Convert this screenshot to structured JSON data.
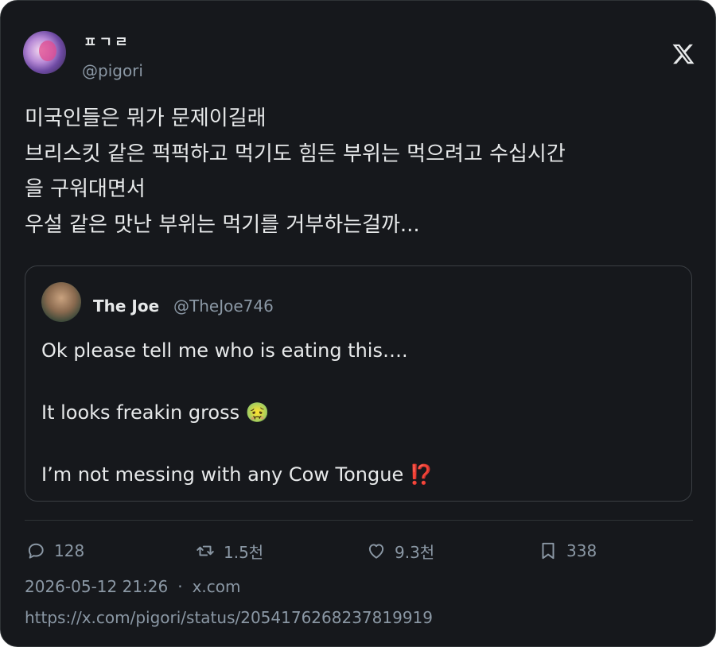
{
  "author": {
    "display_name": "ㅍㄱㄹ",
    "handle": "@pigori"
  },
  "tweet": {
    "lines": [
      "미국인들은 뭐가 문제이길래",
      "브리스킷 같은 퍽퍽하고 먹기도 힘든 부위는 먹으려고 수십시간",
      "을 구워대면서",
      "우설 같은 맛난 부위는 먹기를 거부하는걸까..."
    ]
  },
  "quoted": {
    "display_name": "The Joe",
    "handle": "@TheJoe746",
    "lines": [
      "Ok please tell me who is eating this….",
      "It looks freakin gross 🤢",
      "I’m not messing with any Cow Tongue ⁉️"
    ]
  },
  "actions": {
    "replies": "128",
    "retweets": "1.5천",
    "likes": "9.3천",
    "bookmarks": "338"
  },
  "meta": {
    "timestamp": "2026-05-12 21:26",
    "separator": "·",
    "source": "x.com",
    "url": "https://x.com/pigori/status/2054176268237819919"
  },
  "colors": {
    "background": "#16181c",
    "text_primary": "#e7e9ea",
    "text_secondary": "#8b98a5",
    "border": "#2f3336"
  },
  "icons": [
    "x-logo-icon",
    "reply-icon",
    "retweet-icon",
    "like-icon",
    "bookmark-icon"
  ]
}
